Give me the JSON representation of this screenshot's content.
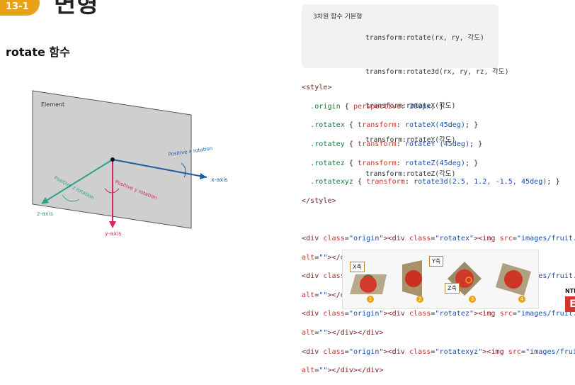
{
  "header": {
    "badge": "13-1",
    "title": "변형"
  },
  "section": {
    "subtitle": "rotate 함수"
  },
  "diagram": {
    "plane_label": "Element",
    "x_axis": "x-axis",
    "y_axis": "y-axis",
    "z_axis": "z-axis",
    "x_rotation": "Positive x rotation",
    "y_rotation": "Positive y rotation",
    "z_rotation": "Positive z rotation",
    "colors": {
      "x": "#1f5fa0",
      "y": "#d6246a",
      "z": "#2aa389",
      "plane": "#cfcfcf"
    }
  },
  "syntax": {
    "label": "3차원 함수 기본형",
    "lines": [
      "transform:rotate(rx, ry, 각도)",
      "transform:rotate3d(rx, ry, rz, 각도)",
      "transform:rotateX(각도)",
      "transform:rotateY(각도)",
      "transform:rotateZ(각도)"
    ]
  },
  "code": {
    "style_open": "<style>",
    "origin_sel": ".origin",
    "origin_prop": "perspective",
    "origin_val": "200px",
    "rules": [
      {
        "sel": ".rotatex",
        "val": "rotateX(45deg)"
      },
      {
        "sel": ".rotatey",
        "val": "rotateY (45deg)"
      },
      {
        "sel": ".rotatez",
        "val": "rotateZ(45deg)"
      },
      {
        "sel": ".rotatexyz",
        "val": "rotate3d(2.5, 1.2, -1.5, 45deg)"
      }
    ],
    "prop_transform": "transform",
    "style_close": "</style>",
    "divs": [
      {
        "cls": "rotatex"
      },
      {
        "cls": "rotatey"
      },
      {
        "cls": "rotatez"
      },
      {
        "cls": "rotatexyz"
      }
    ],
    "origin_cls": "origin",
    "img_src": "images/fruit.jpg"
  },
  "thumbnails": {
    "tags": {
      "x": "X축",
      "y": "Y축",
      "z": "Z축"
    },
    "numbers": [
      "1",
      "2",
      "3",
      "4"
    ]
  },
  "logo": {
    "top": "NTE",
    "box": "E"
  }
}
